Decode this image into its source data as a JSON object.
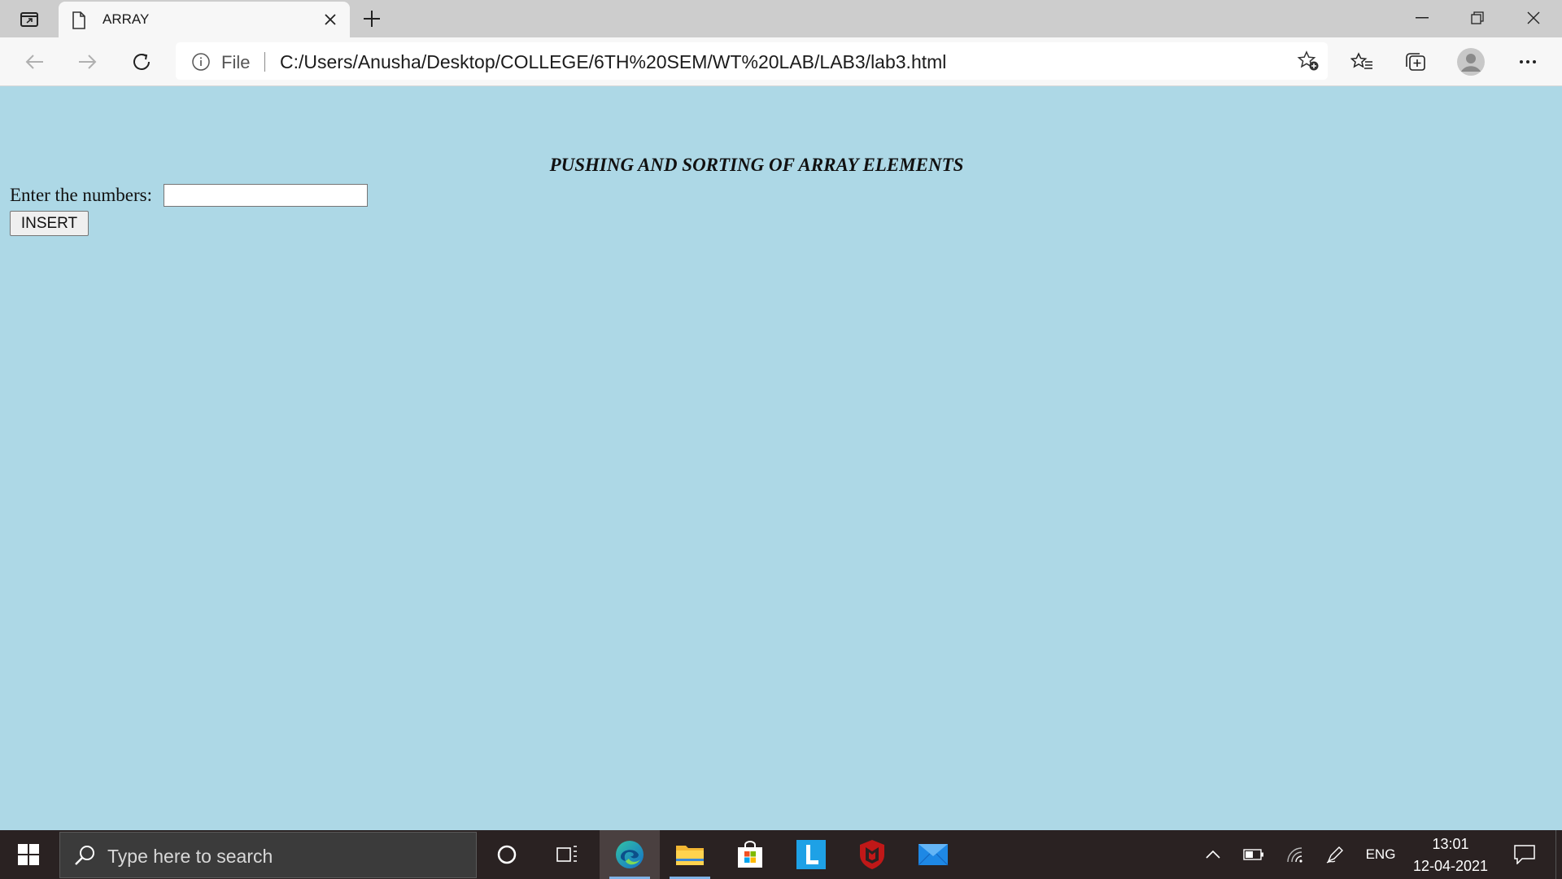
{
  "browser": {
    "tab": {
      "title": "ARRAY"
    },
    "omnibox": {
      "scheme_label": "File",
      "url": "C:/Users/Anusha/Desktop/COLLEGE/6TH%20SEM/WT%20LAB/LAB3/lab3.html"
    }
  },
  "page": {
    "heading": "PUSHING AND SORTING OF ARRAY ELEMENTS",
    "input_label": "Enter the numbers:",
    "input_value": "",
    "insert_label": "INSERT",
    "background_color": "#add8e6"
  },
  "taskbar": {
    "search_placeholder": "Type here to search",
    "pinned_icons": [
      "cortana-icon",
      "task-view-icon",
      "edge-icon",
      "file-explorer-icon",
      "microsoft-store-icon",
      "l-app-icon",
      "mcafee-icon",
      "mail-icon"
    ],
    "tray": {
      "language": "ENG",
      "time": "13:01",
      "date": "12-04-2021"
    }
  }
}
